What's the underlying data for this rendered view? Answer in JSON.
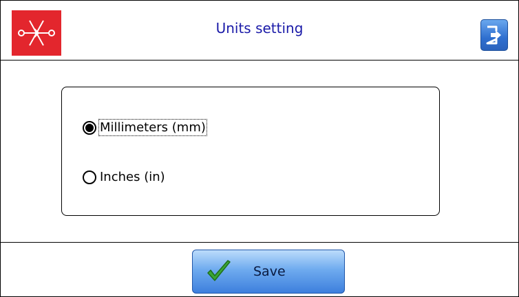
{
  "header": {
    "title": "Units setting",
    "logo_icon": "pipe-weld-icon",
    "exit_icon": "exit-door-icon"
  },
  "units": {
    "options": [
      {
        "label": "Millimeters (mm)",
        "selected": true
      },
      {
        "label": "Inches (in)",
        "selected": false
      }
    ]
  },
  "footer": {
    "save_label": "Save",
    "save_icon": "checkmark-icon"
  },
  "colors": {
    "title": "#1a1aa8",
    "logo_bg": "#e3262d",
    "button_blue": "#3d7fdd",
    "check_green": "#3aa535"
  }
}
